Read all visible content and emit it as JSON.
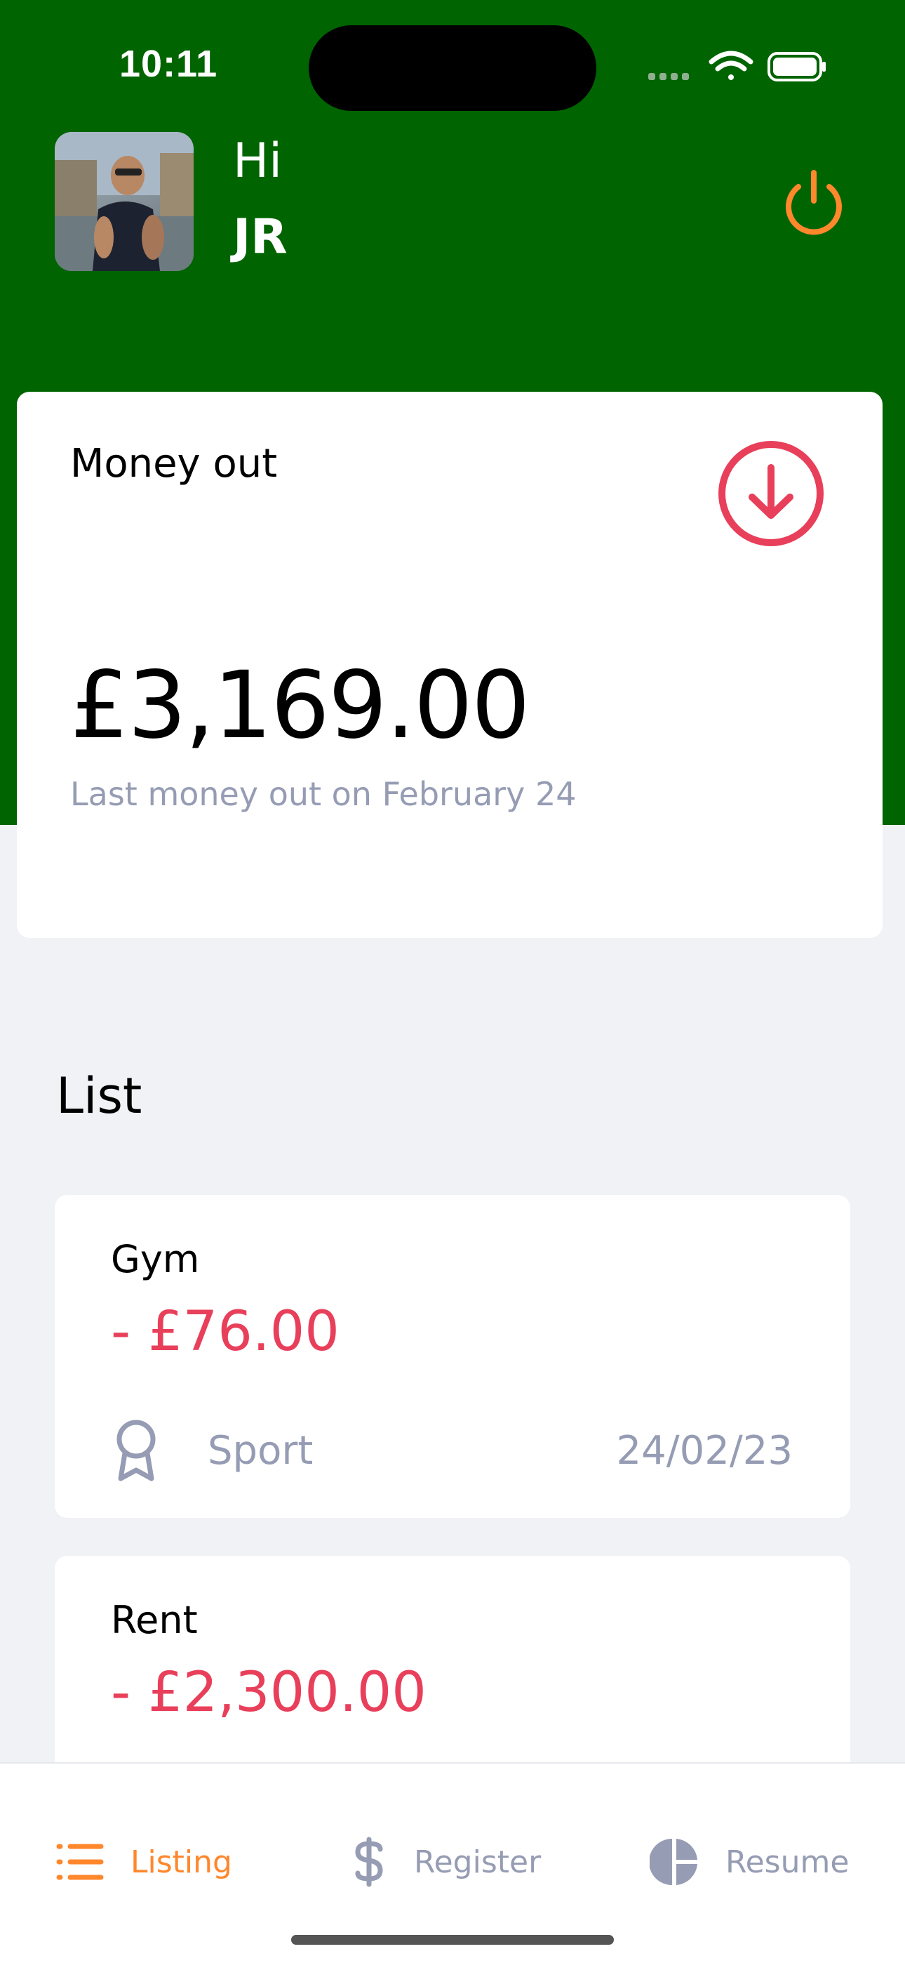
{
  "status_bar": {
    "time": "10:11"
  },
  "header": {
    "greeting": "Hi",
    "user_name": "JR"
  },
  "summary_card": {
    "title": "Money out",
    "amount": "£3,169.00",
    "subtitle": "Last money out on February 24"
  },
  "list": {
    "title": "List",
    "items": [
      {
        "name": "Gym",
        "amount": "- £76.00",
        "category": "Sport",
        "date": "24/02/23"
      },
      {
        "name": "Rent",
        "amount": "- £2,300.00",
        "category": "",
        "date": ""
      }
    ]
  },
  "tabs": [
    {
      "label": "Listing",
      "icon": "list-icon",
      "active": true
    },
    {
      "label": "Register",
      "icon": "dollar-icon",
      "active": false
    },
    {
      "label": "Resume",
      "icon": "pie-chart-icon",
      "active": false
    }
  ],
  "colors": {
    "header_bg": "#006400",
    "accent": "#ff872c",
    "negative": "#e83f5b",
    "muted": "#969cb3"
  }
}
